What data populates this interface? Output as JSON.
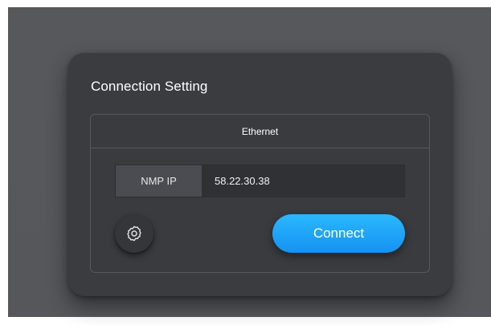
{
  "dialog": {
    "title": "Connection Setting"
  },
  "panel": {
    "header": "Ethernet",
    "ip_label": "NMP IP",
    "ip_value": "58.22.30.38"
  },
  "actions": {
    "settings_icon": "gear-icon",
    "connect_label": "Connect"
  },
  "colors": {
    "backdrop": "#56585c",
    "dialog_bg": "#3a3c40",
    "accent": "#1ea5fa"
  }
}
